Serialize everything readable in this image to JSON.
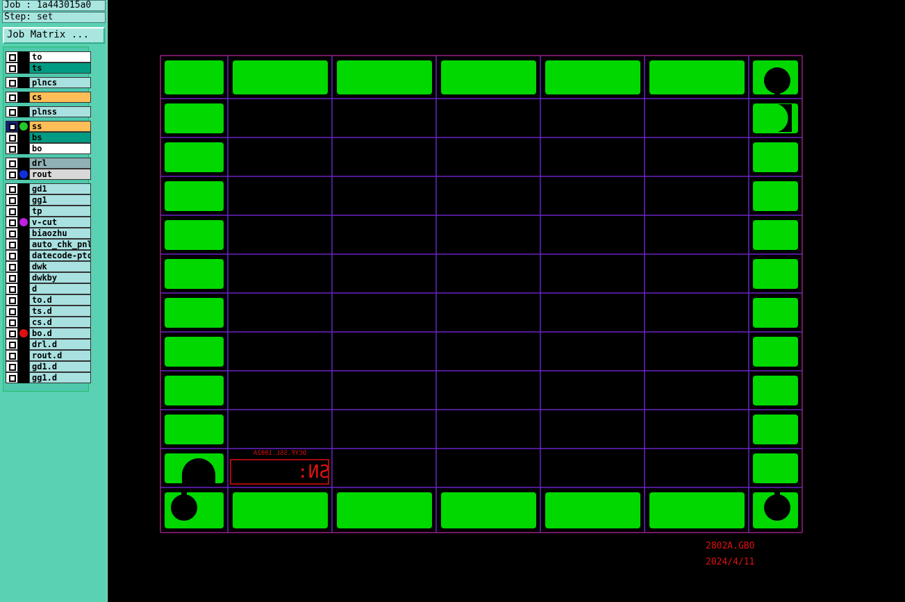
{
  "header": {
    "job": "Job : 1a443015a0",
    "step": "Step: set"
  },
  "job_matrix_label": "Job Matrix ...",
  "layers": [
    {
      "name": "to",
      "color": "#ffffff"
    },
    {
      "name": "ts",
      "color": "#009b82"
    },
    {
      "name": "plncs",
      "color": "#a9e0e0"
    },
    {
      "name": "cs",
      "color": "#ffbe58"
    },
    {
      "name": "plnss",
      "color": "#a9e0e0"
    },
    {
      "name": "ss",
      "color": "#ffbe58",
      "selected": true,
      "indicator": "#22c82a"
    },
    {
      "name": "bs",
      "color": "#009b82"
    },
    {
      "name": "bo",
      "color": "#ffffff"
    },
    {
      "name": "drl",
      "color": "#8fb0b4"
    },
    {
      "name": "rout",
      "color": "#d8d8d8",
      "indicator": "#1030e0"
    },
    {
      "name": "gd1",
      "color": "#a9e0e0"
    },
    {
      "name": "gg1",
      "color": "#a9e0e0"
    },
    {
      "name": "tp",
      "color": "#a9e0e0"
    },
    {
      "name": "v-cut",
      "color": "#a9e0e0",
      "indicator": "#c020e0"
    },
    {
      "name": "biaozhu",
      "color": "#a9e0e0"
    },
    {
      "name": "auto_chk_pnl",
      "color": "#a9e0e0"
    },
    {
      "name": "datecode-ptc",
      "color": "#a9e0e0"
    },
    {
      "name": "dwk",
      "color": "#a9e0e0"
    },
    {
      "name": "dwkby",
      "color": "#a9e0e0"
    },
    {
      "name": "d",
      "color": "#a9e0e0"
    },
    {
      "name": "to.d",
      "color": "#a9e0e0"
    },
    {
      "name": "ts.d",
      "color": "#a9e0e0"
    },
    {
      "name": "cs.d",
      "color": "#a9e0e0"
    },
    {
      "name": "bo.d",
      "color": "#a9e0e0",
      "indicator": "#e01010"
    },
    {
      "name": "drl.d",
      "color": "#a9e0e0"
    },
    {
      "name": "rout.d",
      "color": "#a9e0e0"
    },
    {
      "name": "gd1.d",
      "color": "#a9e0e0"
    },
    {
      "name": "gg1.d",
      "color": "#a9e0e0"
    }
  ],
  "board": {
    "pad_color": "#00d800",
    "grid_color": "#6a22c8",
    "label_color": "#e01010",
    "sn_text": "SN:",
    "small_text": "DCYF.SSL.1802A",
    "file_note": "2802A.GBO",
    "date_note": "2024/4/11"
  }
}
